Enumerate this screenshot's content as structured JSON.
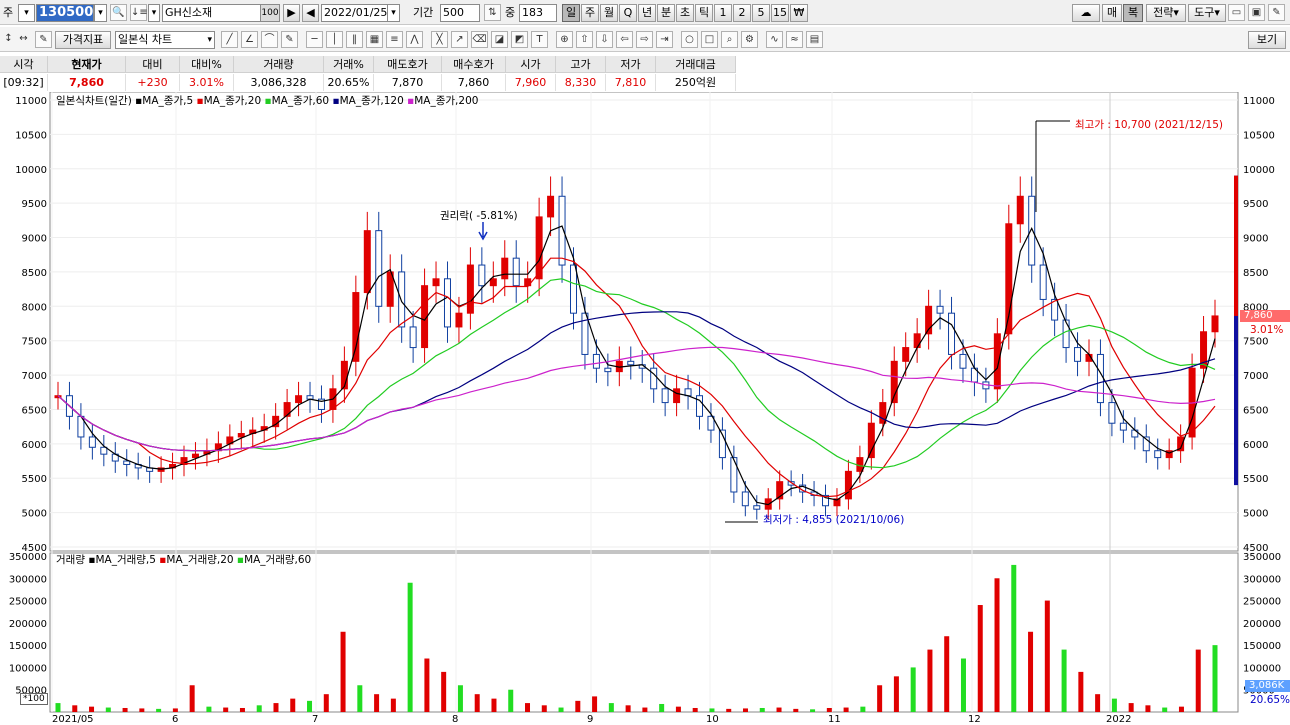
{
  "toolbar1": {
    "type_label": "주",
    "stock_code": "130500",
    "stock_name": "GH신소재",
    "badge": "100",
    "date": "2022/01/25",
    "period_label": "기간",
    "period": "500",
    "weight_label": "중",
    "weight": "183",
    "periods": [
      "일",
      "주",
      "월",
      "Q",
      "년",
      "분",
      "초",
      "틱",
      "1",
      "2",
      "5",
      "15",
      "₩"
    ],
    "right_buttons": [
      "매",
      "복",
      "전략",
      "도구"
    ]
  },
  "toolbar2": {
    "indicator_btn": "가격지표",
    "chart_type": "일본식 차트",
    "view_btn": "보기"
  },
  "quote": {
    "headers": [
      "시각",
      "현재가",
      "대비",
      "대비%",
      "거래량",
      "거래%",
      "매도호가",
      "매수호가",
      "시가",
      "고가",
      "저가",
      "거래대금"
    ],
    "values": [
      "[09:32]",
      "7,860",
      "+230",
      "3.01%",
      "3,086,328",
      "20.65%",
      "7,870",
      "7,860",
      "7,960",
      "8,330",
      "7,810",
      "250억원"
    ]
  },
  "price_panel": {
    "title": "일본식차트(일간)",
    "mas": [
      {
        "label": "MA_종가,5",
        "color": "#000000"
      },
      {
        "label": "MA_종가,20",
        "color": "#e00000"
      },
      {
        "label": "MA_종가,60",
        "color": "#22cc22"
      },
      {
        "label": "MA_종가,120",
        "color": "#000080"
      },
      {
        "label": "MA_종가,200",
        "color": "#cc22cc"
      }
    ],
    "y_ticks": [
      "11000",
      "10500",
      "10000",
      "9500",
      "9000",
      "8500",
      "8000",
      "7500",
      "7000",
      "6500",
      "6000",
      "5500",
      "5000",
      "4500"
    ],
    "high_annotation": "최고가 : 10,700 (2021/12/15)",
    "low_annotation": "최저가 : 4,855 (2021/10/06)",
    "event_annotation": "권리락( -5.81%)",
    "current_price_tag": "7,860",
    "current_pct_tag": "3.01%"
  },
  "volume_panel": {
    "title": "거래량",
    "mas": [
      {
        "label": "MA_거래량,5",
        "color": "#000000"
      },
      {
        "label": "MA_거래량,20",
        "color": "#e00000"
      },
      {
        "label": "MA_거래량,60",
        "color": "#22cc22"
      }
    ],
    "y_ticks": [
      "350000",
      "300000",
      "250000",
      "200000",
      "150000",
      "100000",
      "50000"
    ],
    "unit_label": "*100",
    "current_volume_tag": "3,086K",
    "current_pct": "20.65%"
  },
  "x_axis": [
    "2021/05",
    "6",
    "7",
    "8",
    "9",
    "10",
    "11",
    "12",
    "2022"
  ],
  "chart_data": {
    "type": "candlestick",
    "price_range": [
      4500,
      11000
    ],
    "volume_range": [
      0,
      350000
    ],
    "x_months": [
      "2021/05",
      "6",
      "7",
      "8",
      "9",
      "10",
      "11",
      "12",
      "2022"
    ],
    "key_points": [
      {
        "x": "2021/10/06",
        "y": 4855,
        "label": "최저가"
      },
      {
        "x": "2021/12/15",
        "y": 10700,
        "label": "최고가"
      }
    ],
    "close_path": [
      6700,
      6400,
      6100,
      5950,
      5850,
      5750,
      5700,
      5650,
      5600,
      5650,
      5700,
      5800,
      5850,
      5900,
      6000,
      6100,
      6150,
      6200,
      6250,
      6400,
      6600,
      6700,
      6650,
      6500,
      6800,
      7200,
      8200,
      9100,
      8000,
      8500,
      7700,
      7400,
      8300,
      8400,
      7700,
      7900,
      8600,
      8300,
      8400,
      8700,
      8300,
      8400,
      9300,
      9600,
      8600,
      7900,
      7300,
      7100,
      7050,
      7200,
      7150,
      7100,
      6800,
      6600,
      6800,
      6700,
      6400,
      6200,
      5800,
      5300,
      5100,
      5050,
      5200,
      5450,
      5400,
      5300,
      5250,
      5100,
      5200,
      5600,
      5800,
      6300,
      6600,
      7200,
      7400,
      7600,
      8000,
      7900,
      7300,
      7100,
      6900,
      6800,
      7600,
      9200,
      9600,
      8600,
      8100,
      7800,
      7400,
      7200,
      7300,
      6600,
      6300,
      6200,
      6100,
      5900,
      5800,
      5900,
      6100,
      7100,
      7630,
      7860
    ],
    "volume_values": [
      20000,
      15000,
      12000,
      10000,
      9000,
      8000,
      7000,
      8000,
      60000,
      12000,
      10000,
      9000,
      15000,
      20000,
      30000,
      25000,
      40000,
      180000,
      60000,
      40000,
      30000,
      290000,
      120000,
      90000,
      60000,
      40000,
      30000,
      50000,
      20000,
      15000,
      10000,
      25000,
      35000,
      20000,
      15000,
      10000,
      18000,
      12000,
      9000,
      8000,
      7000,
      8000,
      9000,
      10000,
      7000,
      6000,
      9000,
      10000,
      12000,
      60000,
      80000,
      100000,
      140000,
      170000,
      120000,
      240000,
      300000,
      330000,
      180000,
      250000,
      140000,
      90000,
      40000,
      30000,
      20000,
      15000,
      10000,
      12000,
      140000,
      150000
    ],
    "volume_colors": "red up / green down"
  }
}
